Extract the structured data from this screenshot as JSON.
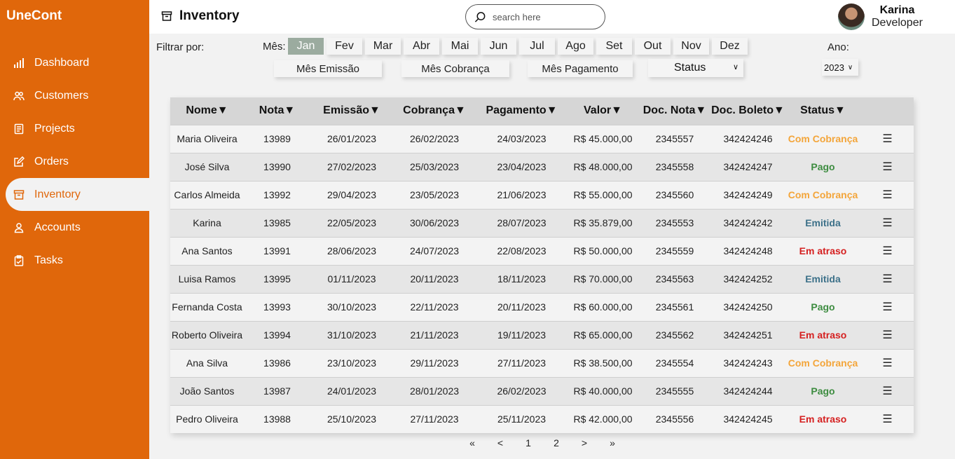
{
  "app": {
    "brand": "UneCont"
  },
  "sidebar": {
    "items": [
      {
        "label": "Dashboard",
        "icon": "bar-chart-icon",
        "active": false
      },
      {
        "label": "Customers",
        "icon": "users-icon",
        "active": false
      },
      {
        "label": "Projects",
        "icon": "document-icon",
        "active": false
      },
      {
        "label": "Orders",
        "icon": "edit-icon",
        "active": false
      },
      {
        "label": "Inventory",
        "icon": "archive-icon",
        "active": true
      },
      {
        "label": "Accounts",
        "icon": "user-icon",
        "active": false
      },
      {
        "label": "Tasks",
        "icon": "clipboard-icon",
        "active": false
      }
    ]
  },
  "header": {
    "title": "Inventory",
    "search_placeholder": "search here",
    "user": {
      "name": "Karina",
      "role": "Developer"
    }
  },
  "filters": {
    "label": "Filtrar por:",
    "mes_label": "Mês:",
    "months": [
      "Jan",
      "Fev",
      "Mar",
      "Abr",
      "Mai",
      "Jun",
      "Jul",
      "Ago",
      "Set",
      "Out",
      "Nov",
      "Dez"
    ],
    "active_month": "Jan",
    "mes_emissao": "Mês Emissão",
    "mes_cobranca": "Mês Cobrança",
    "mes_pagamento": "Mês Pagamento",
    "status_label": "Status",
    "ano_label": "Ano:",
    "ano_value": "2023"
  },
  "table": {
    "columns": [
      "Nome▼",
      "Nota▼",
      "Emissão▼",
      "Cobrança▼",
      "Pagamento▼",
      "Valor▼",
      "Doc. Nota▼",
      "Doc. Boleto▼",
      "Status▼",
      ""
    ],
    "rows": [
      {
        "nome": "Maria Oliveira",
        "nota": "13989",
        "emissao": "26/01/2023",
        "cobranca": "26/02/2023",
        "pagamento": "24/03/2023",
        "valor": "R$ 45.000,00",
        "doc_nota": "2345557",
        "doc_boleto": "342424246",
        "status": "Com Cobrança",
        "status_type": "com"
      },
      {
        "nome": "José Silva",
        "nota": "13990",
        "emissao": "27/02/2023",
        "cobranca": "25/03/2023",
        "pagamento": "23/04/2023",
        "valor": "R$ 48.000,00",
        "doc_nota": "2345558",
        "doc_boleto": "342424247",
        "status": "Pago",
        "status_type": "pago"
      },
      {
        "nome": "Carlos Almeida",
        "nota": "13992",
        "emissao": "29/04/2023",
        "cobranca": "23/05/2023",
        "pagamento": "21/06/2023",
        "valor": "R$ 55.000,00",
        "doc_nota": "2345560",
        "doc_boleto": "342424249",
        "status": "Com Cobrança",
        "status_type": "com"
      },
      {
        "nome": "Karina",
        "nota": "13985",
        "emissao": "22/05/2023",
        "cobranca": "30/06/2023",
        "pagamento": "28/07/2023",
        "valor": "R$ 35.879,00",
        "doc_nota": "2345553",
        "doc_boleto": "342424242",
        "status": "Emitida",
        "status_type": "emitida"
      },
      {
        "nome": "Ana Santos",
        "nota": "13991",
        "emissao": "28/06/2023",
        "cobranca": "24/07/2023",
        "pagamento": "22/08/2023",
        "valor": "R$ 50.000,00",
        "doc_nota": "2345559",
        "doc_boleto": "342424248",
        "status": "Em atraso",
        "status_type": "atraso"
      },
      {
        "nome": "Luisa Ramos",
        "nota": "13995",
        "emissao": "01/11/2023",
        "cobranca": "20/11/2023",
        "pagamento": "18/11/2023",
        "valor": "R$ 70.000,00",
        "doc_nota": "2345563",
        "doc_boleto": "342424252",
        "status": "Emitida",
        "status_type": "emitida"
      },
      {
        "nome": "Fernanda Costa",
        "nota": "13993",
        "emissao": "30/10/2023",
        "cobranca": "22/11/2023",
        "pagamento": "20/11/2023",
        "valor": "R$ 60.000,00",
        "doc_nota": "2345561",
        "doc_boleto": "342424250",
        "status": "Pago",
        "status_type": "pago"
      },
      {
        "nome": "Roberto Oliveira",
        "nota": "13994",
        "emissao": "31/10/2023",
        "cobranca": "21/11/2023",
        "pagamento": "19/11/2023",
        "valor": "R$ 65.000,00",
        "doc_nota": "2345562",
        "doc_boleto": "342424251",
        "status": "Em atraso",
        "status_type": "atraso"
      },
      {
        "nome": "Ana Silva",
        "nota": "13986",
        "emissao": "23/10/2023",
        "cobranca": "29/11/2023",
        "pagamento": "27/11/2023",
        "valor": "R$ 38.500,00",
        "doc_nota": "2345554",
        "doc_boleto": "342424243",
        "status": "Com Cobrança",
        "status_type": "com"
      },
      {
        "nome": "João Santos",
        "nota": "13987",
        "emissao": "24/01/2023",
        "cobranca": "28/01/2023",
        "pagamento": "26/02/2023",
        "valor": "R$ 40.000,00",
        "doc_nota": "2345555",
        "doc_boleto": "342424244",
        "status": "Pago",
        "status_type": "pago"
      },
      {
        "nome": "Pedro Oliveira",
        "nota": "13988",
        "emissao": "25/10/2023",
        "cobranca": "27/11/2023",
        "pagamento": "25/11/2023",
        "valor": "R$ 42.000,00",
        "doc_nota": "2345556",
        "doc_boleto": "342424245",
        "status": "Em atraso",
        "status_type": "atraso"
      }
    ],
    "row_menu_icon": "☰"
  },
  "pagination": {
    "first": "«",
    "prev": "<",
    "pages": [
      "1",
      "2"
    ],
    "next": ">",
    "last": "»"
  },
  "colors": {
    "brand": "#e0670b",
    "status_com_cobranca": "#f3a53a",
    "status_pago": "#3d8c40",
    "status_emitida": "#3d7189",
    "status_em_atraso": "#d52020",
    "month_active": "#9bab9f"
  }
}
